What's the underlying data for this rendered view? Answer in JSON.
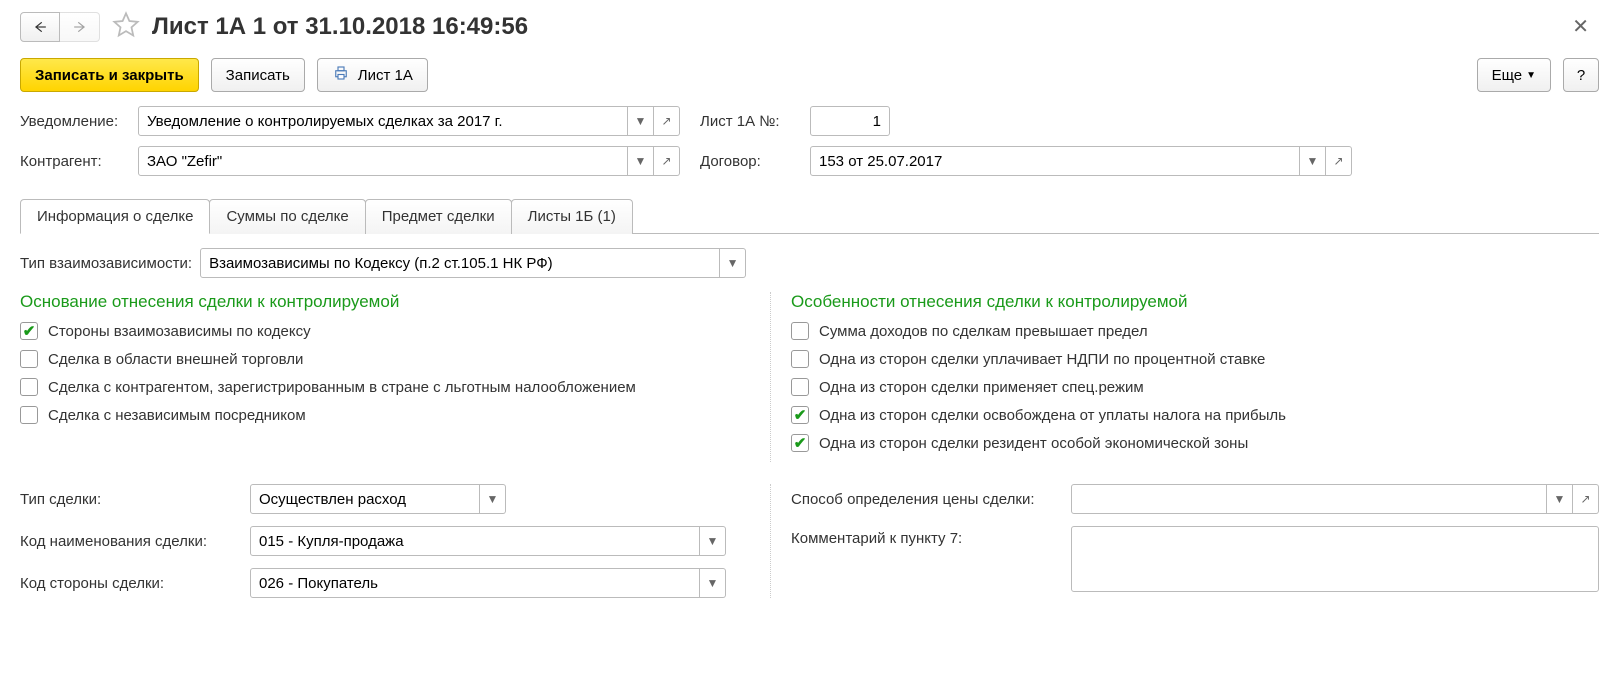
{
  "header": {
    "title": "Лист 1А 1 от 31.10.2018 16:49:56"
  },
  "toolbar": {
    "save_close": "Записать и закрыть",
    "save": "Записать",
    "print_list": "Лист 1А",
    "more": "Еще",
    "help": "?"
  },
  "fields": {
    "notification_label": "Уведомление:",
    "notification_value": "Уведомление о контролируемых сделках за 2017 г.",
    "sheet_no_label": "Лист 1А №:",
    "sheet_no_value": "1",
    "counterparty_label": "Контрагент:",
    "counterparty_value": "ЗАО \"Zefir\"",
    "contract_label": "Договор:",
    "contract_value": "153 от 25.07.2017"
  },
  "tabs": {
    "t0": "Информация о сделке",
    "t1": "Суммы по сделке",
    "t2": "Предмет сделки",
    "t3": "Листы 1Б (1)"
  },
  "body": {
    "dep_type_label": "Тип взаимозависимости:",
    "dep_type_value": "Взаимозависимы по Кодексу (п.2 ст.105.1 НК РФ)",
    "left_title": "Основание отнесения сделки к контролируемой",
    "right_title": "Особенности отнесения сделки к контролируемой",
    "left_checks": {
      "c0": "Стороны взаимозависимы по кодексу",
      "c1": "Сделка в области внешней торговли",
      "c2": "Сделка с контрагентом, зарегистрированным в стране с льготным налообложением",
      "c3": "Сделка с независимым посредником"
    },
    "right_checks": {
      "c0": "Сумма доходов по сделкам превышает предел",
      "c1": "Одна из сторон сделки уплачивает НДПИ по процентной ставке",
      "c2": "Одна из сторон сделки применяет спец.режим",
      "c3": "Одна из сторон сделки освобождена от уплаты налога на прибыль",
      "c4": "Одна из сторон сделки резидент особой экономической зоны"
    },
    "deal_type_label": "Тип сделки:",
    "deal_type_value": "Осуществлен расход",
    "deal_name_code_label": "Код наименования сделки:",
    "deal_name_code_value": "015 - Купля-продажа",
    "deal_side_code_label": "Код стороны сделки:",
    "deal_side_code_value": "026 - Покупатель",
    "price_method_label": "Способ определения цены сделки:",
    "price_method_value": "",
    "comment7_label": "Комментарий к пункту 7:",
    "comment7_value": ""
  }
}
